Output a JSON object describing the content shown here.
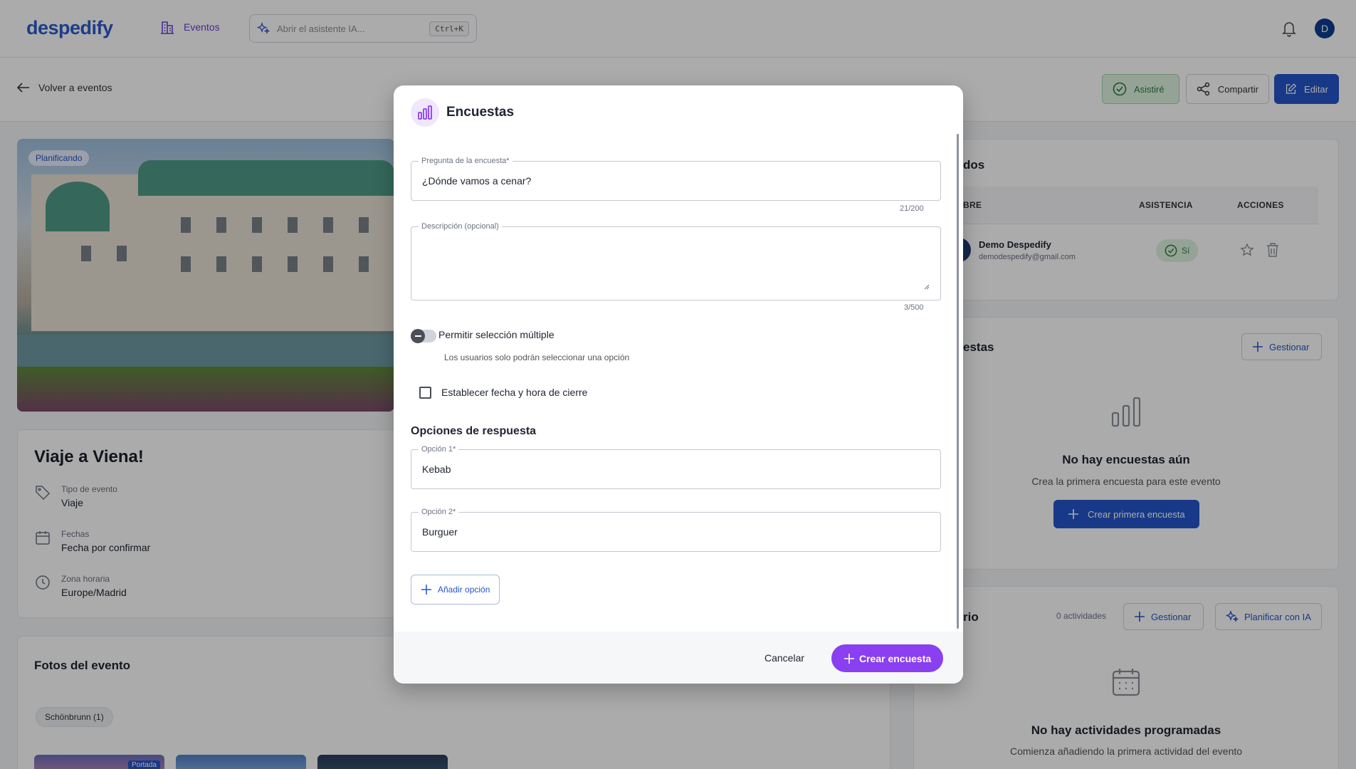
{
  "header": {
    "logo": "despedify",
    "nav_events": "Eventos",
    "ai_placeholder": "Abrir el asistente IA...",
    "shortcut": "Ctrl+K",
    "avatar_initial": "D"
  },
  "subbar": {
    "back_label": "Volver a eventos",
    "attend_label": "Asistiré",
    "share_label": "Compartir",
    "edit_label": "Editar"
  },
  "event": {
    "status_badge": "Planificando",
    "title": "Viaje a Viena!",
    "type_label": "Tipo de evento",
    "type_value": "Viaje",
    "dates_label": "Fechas",
    "dates_value": "Fecha por confirmar",
    "tz_label": "Zona horaria",
    "tz_value": "Europe/Madrid"
  },
  "photos": {
    "title": "Fotos del evento",
    "album_chip": "Schönbrunn (1)",
    "cover_badge": "Portada"
  },
  "attendees": {
    "title_fragment": "dos",
    "col_name": "BRE",
    "col_attendance": "ASISTENCIA",
    "col_actions": "ACCIONES",
    "rows": [
      {
        "name": "Demo Despedify",
        "email": "demodespedify@gmail.com",
        "attendance": "Sí"
      }
    ]
  },
  "polls_card": {
    "title_fragment": "estas",
    "manage_label": "Gestionar",
    "empty_title": "No hay encuestas aún",
    "empty_sub": "Crea la primera encuesta para este evento",
    "create_first_label": "Crear primera encuesta"
  },
  "agenda_card": {
    "title_fragment": "rio",
    "count_label": "0 actividades",
    "manage_label": "Gestionar",
    "plan_ai_label": "Planificar con IA",
    "empty_title": "No hay actividades programadas",
    "empty_sub": "Comienza añadiendo la primera actividad del evento"
  },
  "modal": {
    "title": "Encuestas",
    "question_legend": "Pregunta de la encuesta*",
    "question_value": "¿Dónde vamos a cenar?",
    "question_counter": "21/200",
    "description_legend": "Descripción (opcional)",
    "description_value": "",
    "description_counter": "3/500",
    "multi_select_label": "Permitir selección múltiple",
    "multi_select_help": "Los usuarios solo podrán seleccionar una opción",
    "close_date_label": "Establecer fecha y hora de cierre",
    "options_title": "Opciones de respuesta",
    "options": [
      {
        "legend": "Opción 1*",
        "value": "Kebab"
      },
      {
        "legend": "Opción 2*",
        "value": "Burguer"
      }
    ],
    "add_option_label": "Añadir opción",
    "cancel_label": "Cancelar",
    "create_label": "Crear encuesta"
  },
  "colors": {
    "accent_purple": "#8a3ff0",
    "primary_blue": "#2456c9",
    "success_green": "#2d7a3b"
  }
}
